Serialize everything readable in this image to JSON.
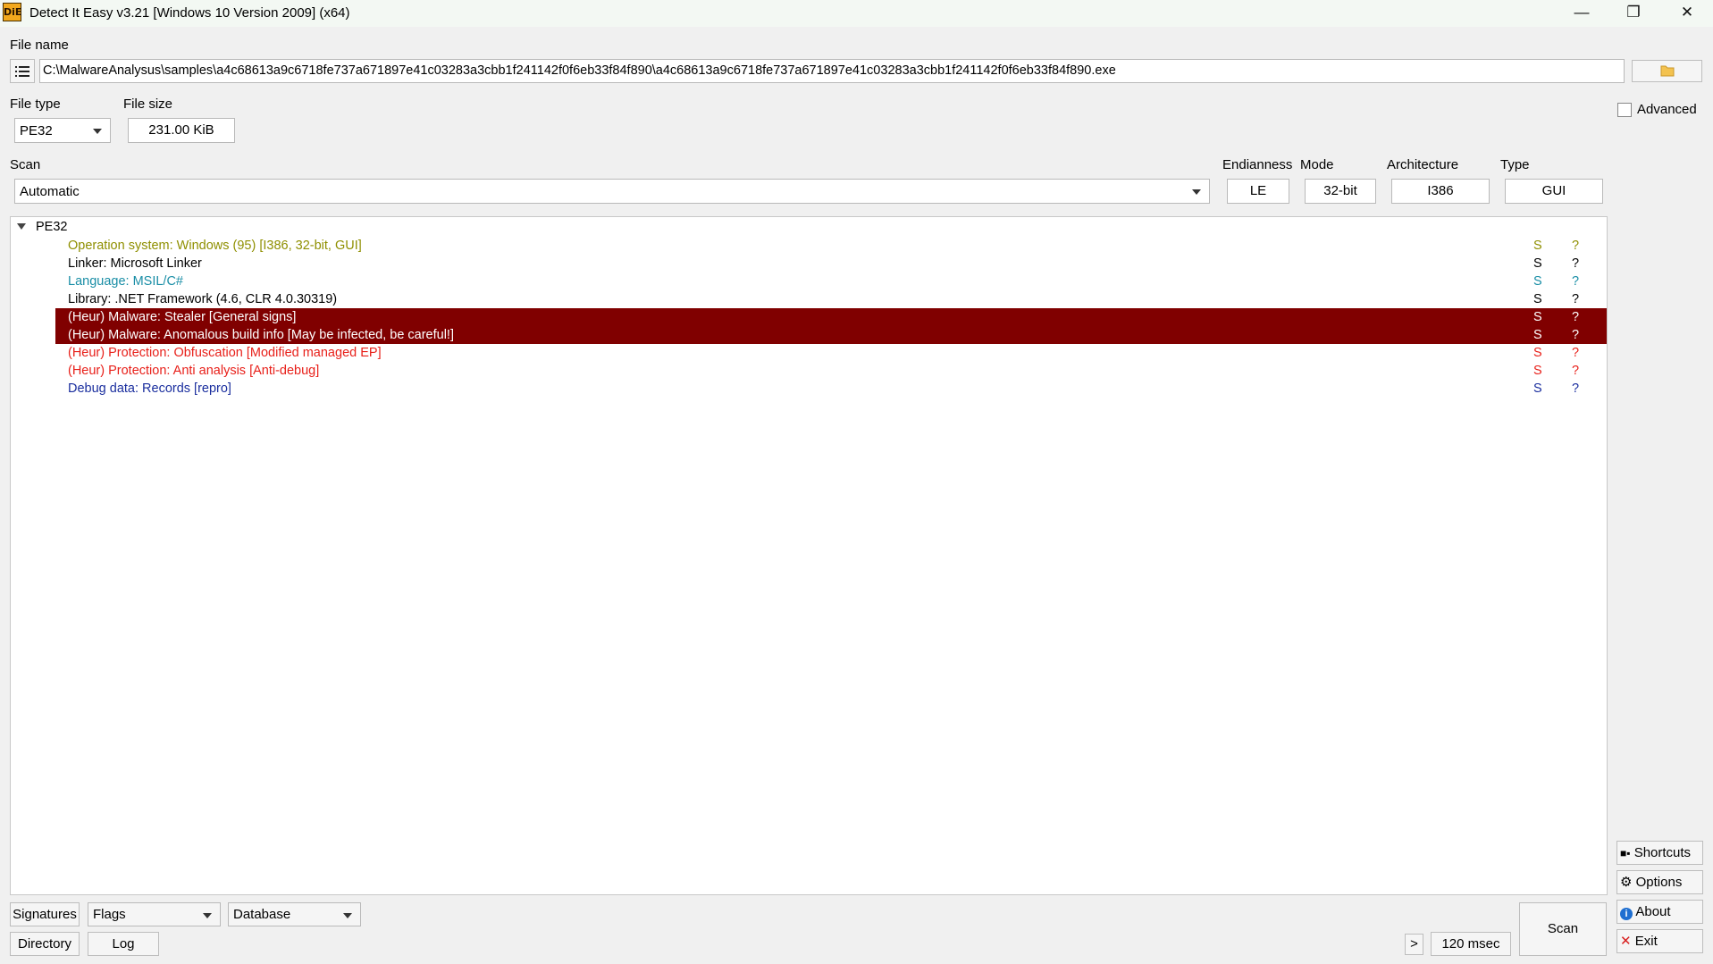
{
  "window": {
    "title": "Detect It Easy v3.21 [Windows 10 Version 2009] (x64)",
    "app_icon_text": "DiE",
    "minimize": "—",
    "maximize": "❐",
    "close": "✕"
  },
  "file": {
    "label": "File name",
    "path": "C:\\MalwareAnalysus\\samples\\a4c68613a9c6718fe737a671897e41c03283a3cbb1f241142f0f6eb33f84f890\\a4c68613a9c6718fe737a671897e41c03283a3cbb1f241142f0f6eb33f84f890.exe"
  },
  "file_type": {
    "label": "File type",
    "value": "PE32"
  },
  "file_size": {
    "label": "File size",
    "value": "231.00 KiB"
  },
  "advanced": {
    "label": "Advanced",
    "checked": false
  },
  "scan": {
    "label": "Scan",
    "value": "Automatic"
  },
  "endianness": {
    "label": "Endianness",
    "value": "LE"
  },
  "mode": {
    "label": "Mode",
    "value": "32-bit"
  },
  "architecture": {
    "label": "Architecture",
    "value": "I386"
  },
  "type": {
    "label": "Type",
    "value": "GUI"
  },
  "results": {
    "root": "PE32",
    "rows": [
      {
        "text": "Operation system: Windows (95) [I386, 32-bit, GUI]",
        "s": "S",
        "q": "?",
        "color": "#8f8f00",
        "selected": false
      },
      {
        "text": "Linker: Microsoft Linker",
        "s": "S",
        "q": "?",
        "color": "#000000",
        "selected": false
      },
      {
        "text": "Language: MSIL/C#",
        "s": "S",
        "q": "?",
        "color": "#1a8ea6",
        "selected": false
      },
      {
        "text": "Library: .NET Framework (4.6, CLR 4.0.30319)",
        "s": "S",
        "q": "?",
        "color": "#000000",
        "selected": false
      },
      {
        "text": "(Heur) Malware: Stealer [General signs]",
        "s": "S",
        "q": "?",
        "color": "#ffffff",
        "selected": true
      },
      {
        "text": "(Heur) Malware: Anomalous build info [May be infected, be careful!]",
        "s": "S",
        "q": "?",
        "color": "#ffffff",
        "selected": true
      },
      {
        "text": "(Heur) Protection: Obfuscation [Modified managed EP]",
        "s": "S",
        "q": "?",
        "color": "#e8201a",
        "selected": false
      },
      {
        "text": "(Heur) Protection: Anti analysis [Anti-debug]",
        "s": "S",
        "q": "?",
        "color": "#e8201a",
        "selected": false
      },
      {
        "text": "Debug data: Records [repro]",
        "s": "S",
        "q": "?",
        "color": "#1a2e9e",
        "selected": false
      }
    ]
  },
  "bottom": {
    "signatures": "Signatures",
    "flags": "Flags",
    "database": "Database",
    "directory": "Directory",
    "log": "Log",
    "more": ">",
    "time": "120 msec",
    "scan": "Scan"
  },
  "side": {
    "shortcuts": "Shortcuts",
    "options": "Options",
    "about": "About",
    "exit": "Exit"
  },
  "colors": {
    "selection": "#800000",
    "titlebar": "#f3f8f3"
  }
}
